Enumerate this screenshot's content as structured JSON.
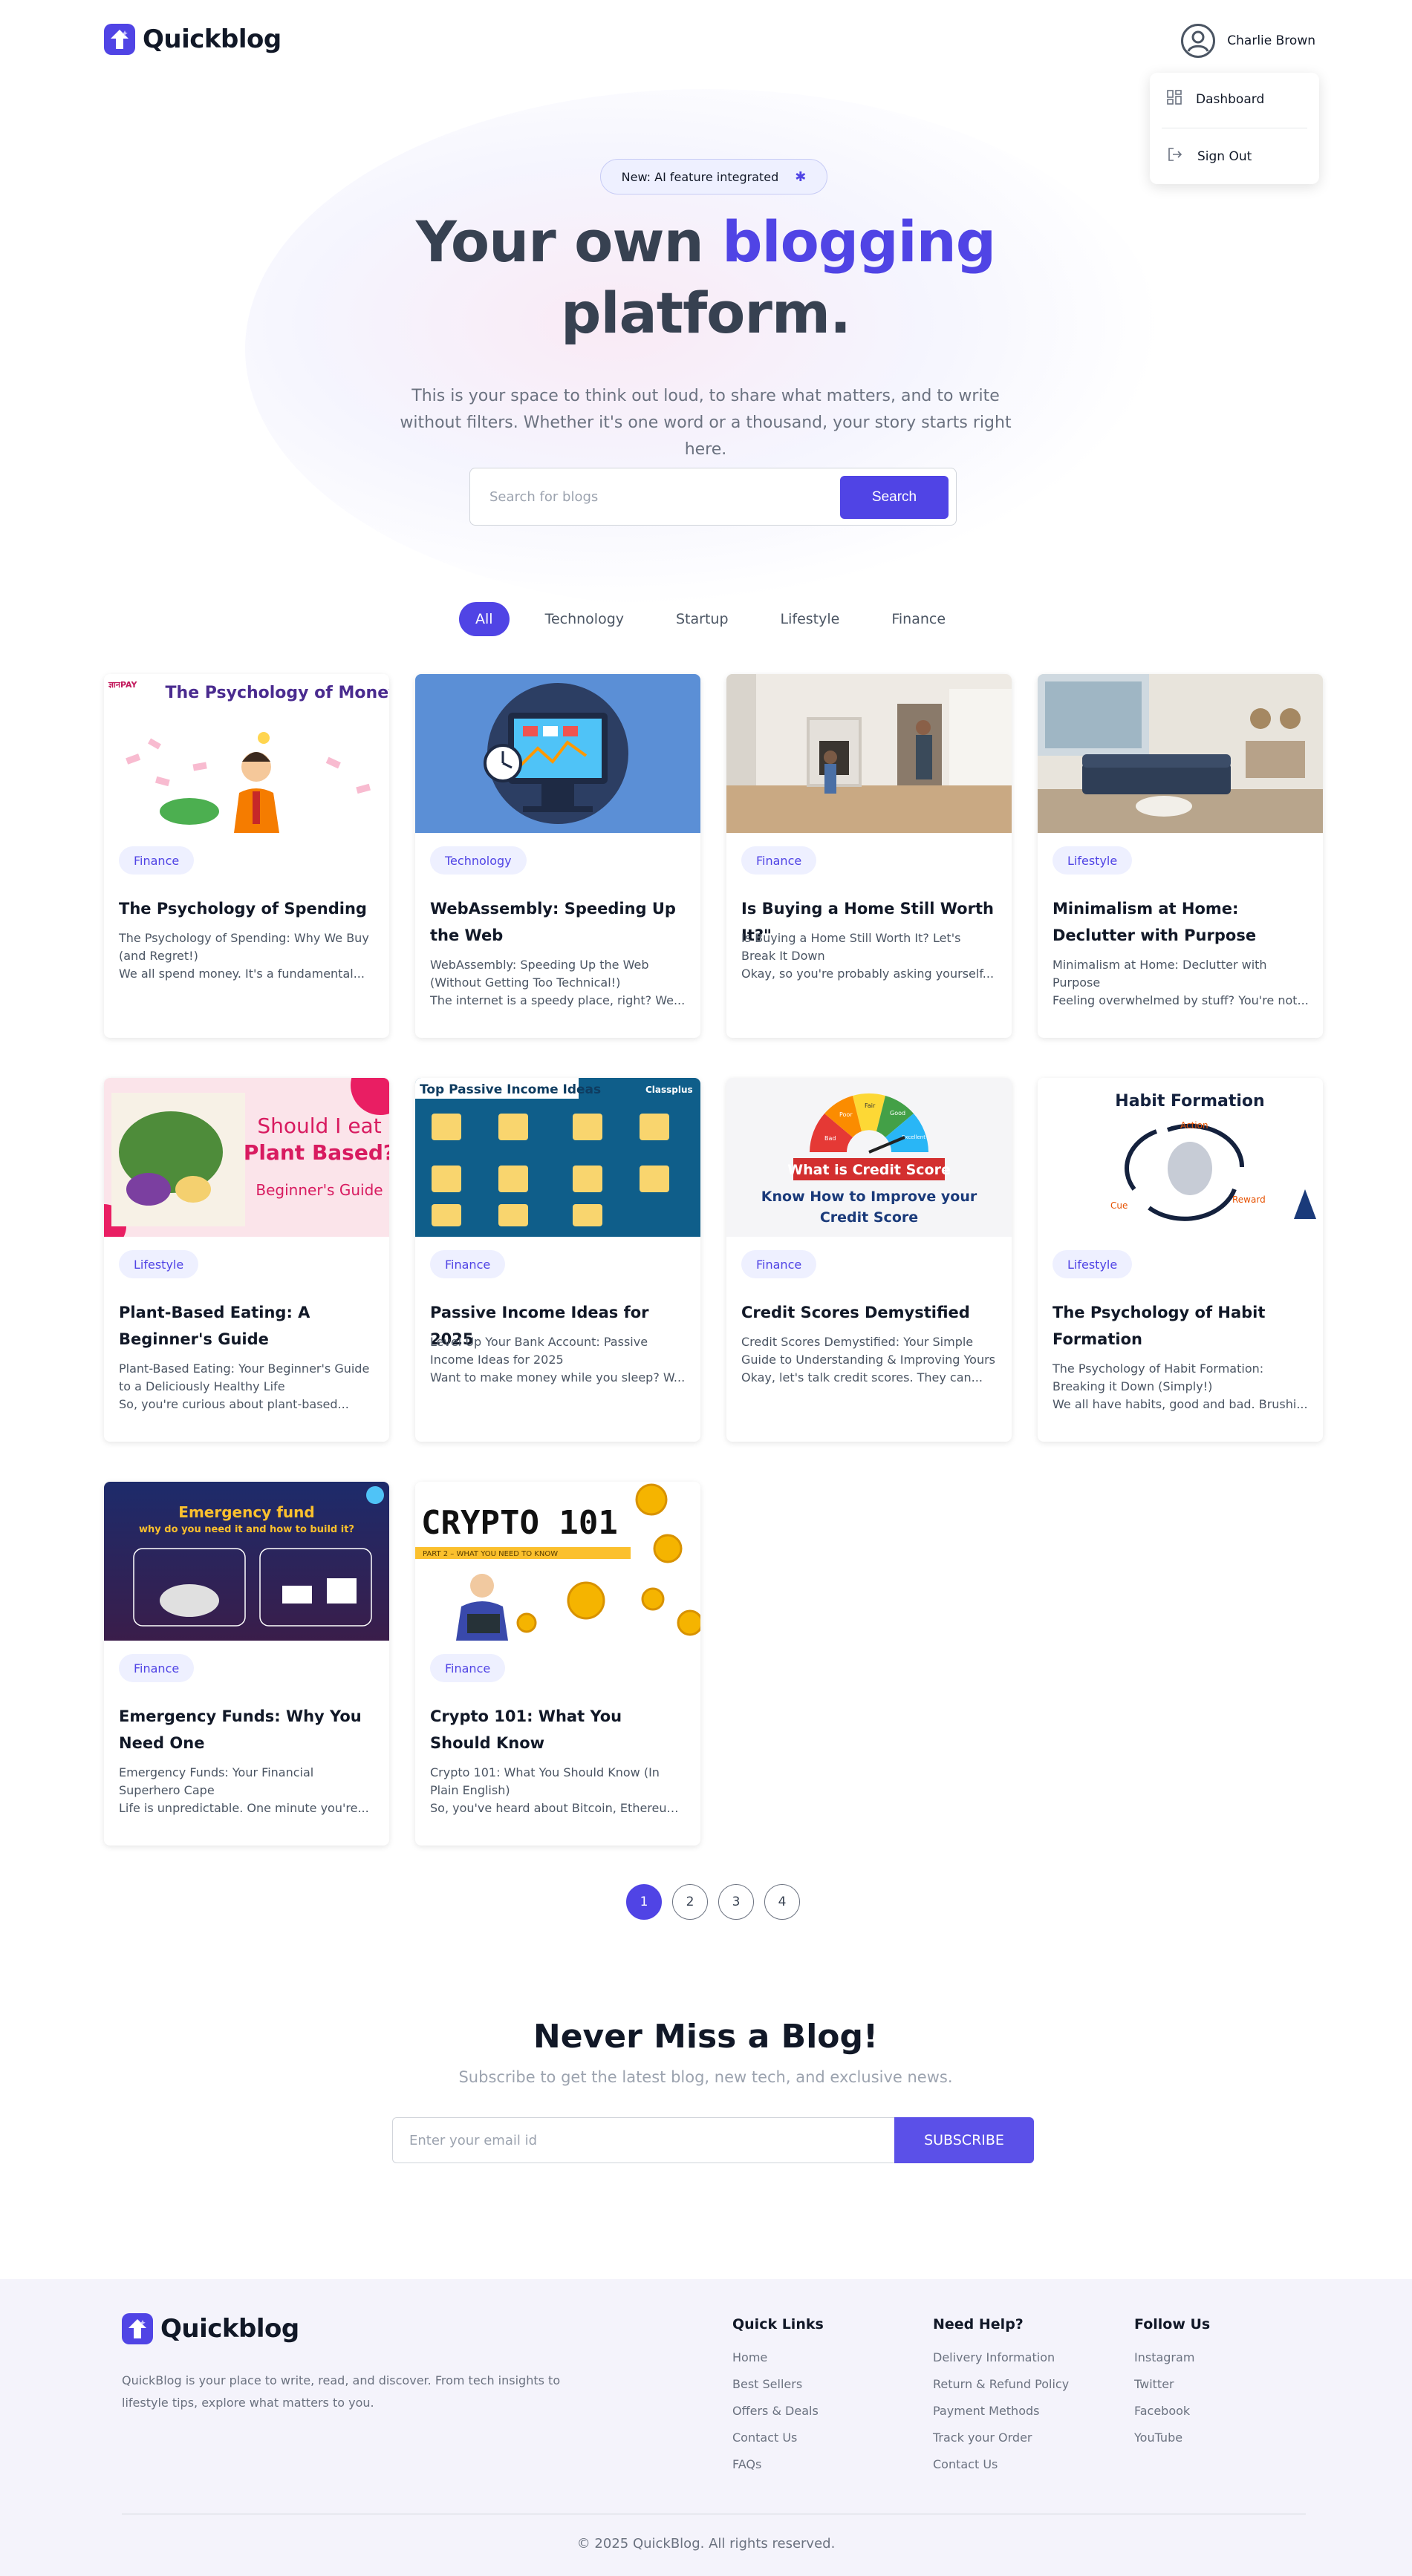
{
  "header": {
    "logo_text": "Quickblog",
    "user_name": "Charlie Brown"
  },
  "dropdown": {
    "dashboard": "Dashboard",
    "sign_out": "Sign Out"
  },
  "hero": {
    "badge": "New: AI feature integrated",
    "title_part1": "Your own ",
    "title_accent": "blogging",
    "title_part2": "platform.",
    "subtitle": "This is your space to think out loud, to share what matters, and to write without filters. Whether it's one word or a thousand, your story starts right here.",
    "search_placeholder": "Search for blogs",
    "search_button": "Search"
  },
  "filters": [
    "All",
    "Technology",
    "Startup",
    "Lifestyle",
    "Finance"
  ],
  "posts": [
    {
      "category": "Finance",
      "title": "The Psychology of Spending",
      "desc_line1": "The Psychology of Spending: Why We Buy (and Regret!)",
      "desc_line2": "We all spend money. It's a fundamental...",
      "image_text": "The Psychology of Money",
      "image_brand": "ज्ञानPAY"
    },
    {
      "category": "Technology",
      "title": "WebAssembly: Speeding Up the Web",
      "desc_line1": "WebAssembly: Speeding Up the Web (Without Getting Too Technical!)",
      "desc_line2": "The internet is a speedy place, right? We..."
    },
    {
      "category": "Finance",
      "title": "Is Buying a Home Still Worth It?\"",
      "desc_line1": "Is Buying a Home Still Worth It? Let's Break It Down",
      "desc_line2": "Okay, so you're probably asking yourself..."
    },
    {
      "category": "Lifestyle",
      "title": "Minimalism at Home: Declutter with Purpose",
      "desc_line1": "Minimalism at Home: Declutter with Purpose",
      "desc_line2": "Feeling overwhelmed by stuff? You're not..."
    },
    {
      "category": "Lifestyle",
      "title": "Plant-Based Eating: A Beginner's Guide",
      "desc_line1": "Plant-Based Eating: Your Beginner's Guide to a Deliciously Healthy Life",
      "desc_line2": "So, you're curious about plant-based...",
      "image_text1": "Should I eat",
      "image_text2": "Plant Based?",
      "image_text3": "Beginner's Guide"
    },
    {
      "category": "Finance",
      "title": "Passive Income Ideas for 2025",
      "desc_line1": "Level Up Your Bank Account: Passive Income Ideas for 2025",
      "desc_line2": "Want to make money while you sleep? W...",
      "image_text": "Top Passive Income Ideas",
      "image_brand": "Classplus"
    },
    {
      "category": "Finance",
      "title": "Credit Scores Demystified",
      "desc_line1": "Credit Scores Demystified: Your Simple Guide to Understanding & Improving Yours",
      "desc_line2": "Okay, let's talk credit scores. They can...",
      "image_text1": "What is Credit Score",
      "image_text2": "Know How to Improve your",
      "image_text3": "Credit Score",
      "gauge_labels": [
        "Bad",
        "Poor",
        "Fair",
        "Good",
        "Excellent"
      ]
    },
    {
      "category": "Lifestyle",
      "title": "The Psychology of Habit Formation",
      "desc_line1": "The Psychology of Habit Formation: Breaking it Down (Simply!)",
      "desc_line2": "We all have habits, good and bad. Brushi...",
      "image_text": "Habit Formation",
      "cycle_labels": [
        "Action",
        "Reward",
        "Cue"
      ]
    },
    {
      "category": "Finance",
      "title": "Emergency Funds: Why You Need One",
      "desc_line1": "Emergency Funds: Your Financial Superhero Cape",
      "desc_line2": "Life is unpredictable. One minute you're...",
      "image_text1": "Emergency fund",
      "image_text2": "why do you need it and how to build it?"
    },
    {
      "category": "Finance",
      "title": "Crypto 101: What You Should Know",
      "desc_line1": "Crypto 101: What You Should Know (In Plain English)",
      "desc_line2": "So, you've heard about Bitcoin, Ethereum...",
      "image_text1": "CRYPTO 101",
      "image_text2": "PART 2 – WHAT YOU NEED TO KNOW"
    }
  ],
  "pagination": [
    "1",
    "2",
    "3",
    "4"
  ],
  "newsletter": {
    "title": "Never Miss a Blog!",
    "subtitle": "Subscribe to get the latest blog, new tech, and exclusive news.",
    "placeholder": "Enter your email id",
    "button": "SUBSCRIBE"
  },
  "footer": {
    "logo_text": "Quickblog",
    "about": "QuickBlog is your place to write, read, and discover. From tech insights to lifestyle tips, explore what matters to you.",
    "columns": [
      {
        "title": "Quick Links",
        "links": [
          "Home",
          "Best Sellers",
          "Offers & Deals",
          "Contact Us",
          "FAQs"
        ]
      },
      {
        "title": "Need Help?",
        "links": [
          "Delivery Information",
          "Return & Refund Policy",
          "Payment Methods",
          "Track your Order",
          "Contact Us"
        ]
      },
      {
        "title": "Follow Us",
        "links": [
          "Instagram",
          "Twitter",
          "Facebook",
          "YouTube"
        ]
      }
    ],
    "copyright": "© 2025 QuickBlog. All rights reserved."
  },
  "colors": {
    "accent": "#5044e5",
    "tag_bg": "#eef0ff",
    "footer_bg": "#f4f3fb"
  },
  "icons": [
    "logo-icon",
    "user-avatar-icon",
    "dashboard-icon",
    "sign-out-icon",
    "sparkle-icon"
  ]
}
